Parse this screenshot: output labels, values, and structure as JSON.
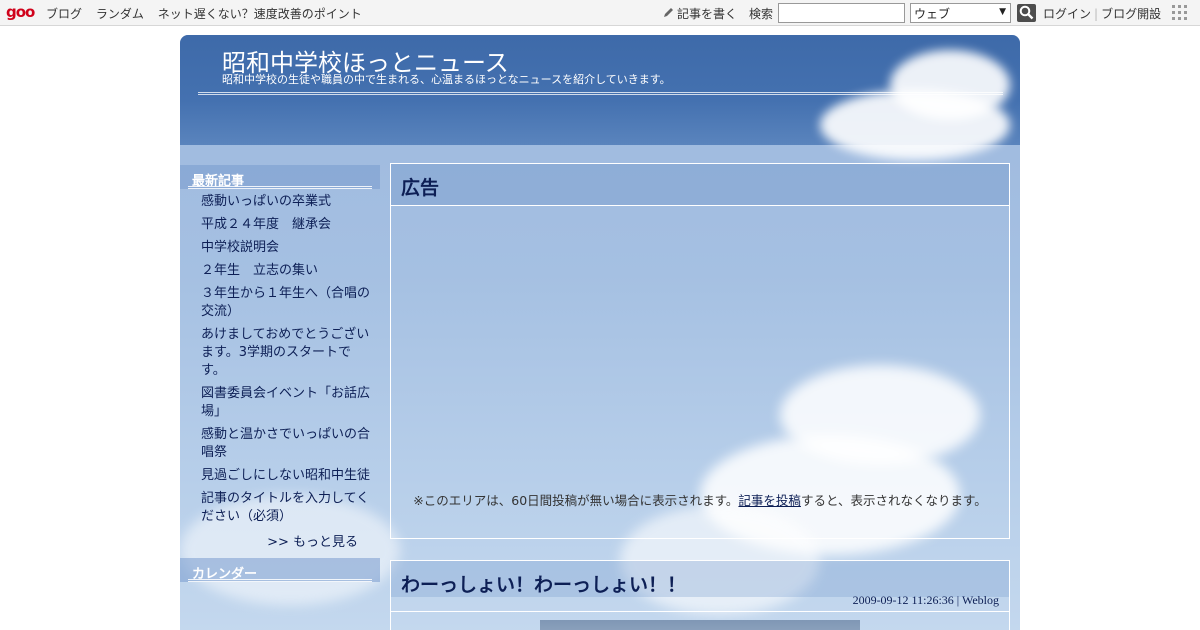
{
  "topbar": {
    "logo": "goo",
    "nav": [
      "ブログ",
      "ランダム",
      "ネット遅くない？速度改善のポイント"
    ],
    "write_label": "記事を書く",
    "search_label": "検索",
    "search_value": "",
    "search_scope": "ウェブ",
    "login": "ログイン",
    "signup": "ブログ開設"
  },
  "header": {
    "title": "昭和中学校ほっとニュース",
    "description": "昭和中学校の生徒や職員の中で生まれる、心温まるほっとなニュースを紹介していきます。"
  },
  "sidebar": {
    "recent_heading": "最新記事",
    "recent_items": [
      "感動いっぱいの卒業式",
      "平成２４年度　継承会",
      "中学校説明会",
      "２年生　立志の集い",
      "３年生から１年生へ（合唱の交流）",
      "あけましておめでとうございます。3学期のスタートです。",
      "図書委員会イベント「お話広場」",
      "感動と温かさでいっぱいの合唱祭",
      "見過ごしにしない昭和中生徒",
      "記事のタイトルを入力してください（必須）"
    ],
    "more_label": ">> もっと見る",
    "calendar_heading": "カレンダー"
  },
  "ad": {
    "heading": "広告",
    "note_before": "※このエリアは、60日間投稿が無い場合に表示されます。",
    "note_link": "記事を投稿",
    "note_after": "すると、表示されなくなります。"
  },
  "post": {
    "title": "わーっしょい！わーっしょい！！",
    "meta": "2009-09-12 11:26:36 | Weblog"
  }
}
